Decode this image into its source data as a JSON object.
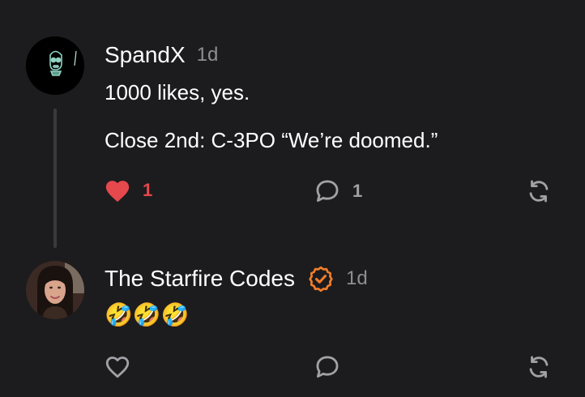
{
  "posts": [
    {
      "author": "SpandX",
      "time": "1d",
      "paragraphs": [
        "1000 likes, yes.",
        "Close 2nd: C-3PO “We’re doomed.”"
      ],
      "like_count": "1",
      "reply_count": "1",
      "liked": true,
      "avatar_icon": "skull-icon"
    },
    {
      "author": "The Starfire Codes",
      "time": "1d",
      "verified": true,
      "text": "🤣🤣🤣",
      "liked": false,
      "avatar_icon": "woman-portrait"
    }
  ],
  "colors": {
    "background": "#1c1c1e",
    "like_active": "#e5484d",
    "verified": "#f07d2a",
    "muted": "#8e8e93"
  }
}
